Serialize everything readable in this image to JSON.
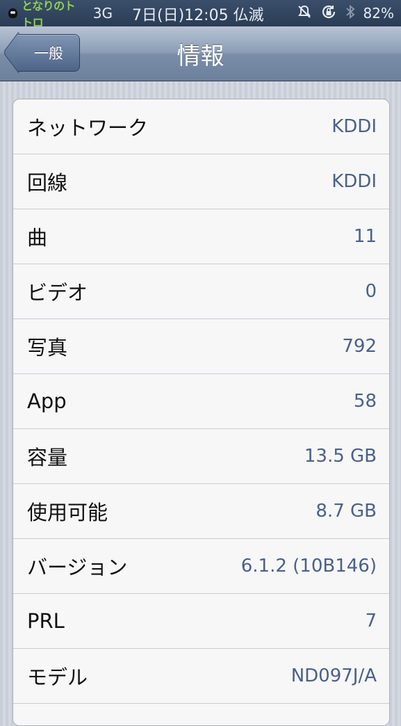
{
  "status_bar": {
    "carrier": "となりのトトロ",
    "network": "3G",
    "datetime": "7日(日)12:05 仏滅",
    "battery": "82%",
    "battery_level": 0.82,
    "icons": [
      "owl-icon",
      "bell-muted-icon",
      "rotation-lock-icon",
      "bluetooth-icon",
      "battery-icon"
    ]
  },
  "nav": {
    "back_label": "一般",
    "title": "情報"
  },
  "rows": [
    {
      "label": "ネットワーク",
      "value": "KDDI"
    },
    {
      "label": "回線",
      "value": "KDDI"
    },
    {
      "label": "曲",
      "value": "11"
    },
    {
      "label": "ビデオ",
      "value": "0"
    },
    {
      "label": "写真",
      "value": "792"
    },
    {
      "label": "App",
      "value": "58"
    },
    {
      "label": "容量",
      "value": "13.5 GB"
    },
    {
      "label": "使用可能",
      "value": "8.7 GB"
    },
    {
      "label": "バージョン",
      "value": "6.1.2 (10B146)"
    },
    {
      "label": "PRL",
      "value": "7"
    },
    {
      "label": "モデル",
      "value": "ND097J/A"
    }
  ],
  "colors": {
    "value_text": "#4b6089",
    "nav_bar": "#7a8da8",
    "background": "#cdd2db"
  }
}
